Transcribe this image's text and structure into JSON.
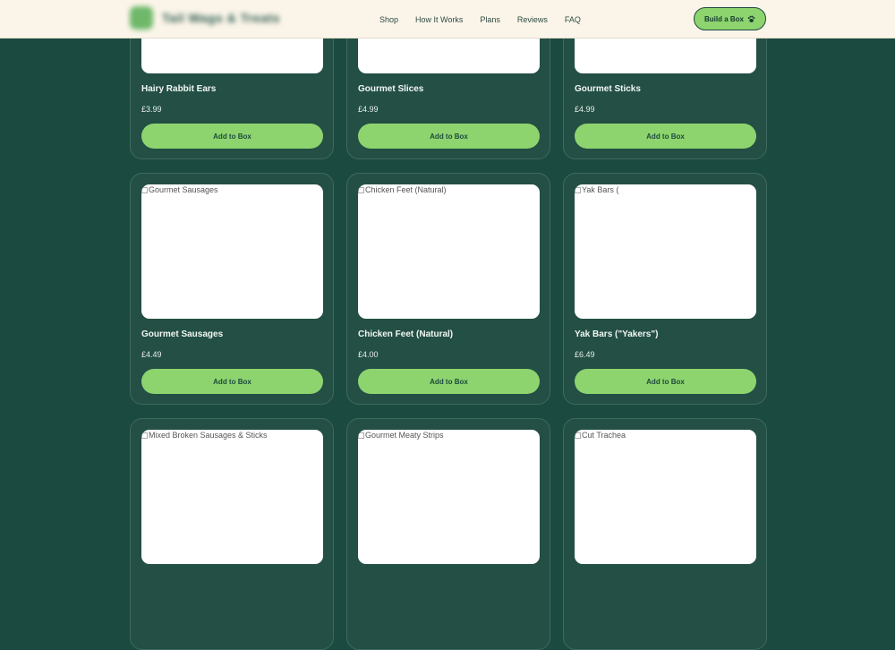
{
  "header": {
    "brand": "Tail Wags & Treats",
    "nav": [
      "Shop",
      "How It Works",
      "Plans",
      "Reviews",
      "FAQ"
    ],
    "cta_label": "Build a Box"
  },
  "products": [
    {
      "name": "Hairy Rabbit Ears",
      "price": "£3.99",
      "alt": "",
      "button": "Add to Box"
    },
    {
      "name": "Gourmet Slices",
      "price": "£4.99",
      "alt": "",
      "button": "Add to Box"
    },
    {
      "name": "Gourmet Sticks",
      "price": "£4.99",
      "alt": "",
      "button": "Add to Box"
    },
    {
      "name": "Gourmet Sausages",
      "price": "£4.49",
      "alt": "Gourmet Sausages",
      "button": "Add to Box"
    },
    {
      "name": "Chicken Feet (Natural)",
      "price": "£4.00",
      "alt": "Chicken Feet (Natural)",
      "button": "Add to Box"
    },
    {
      "name": "Yak Bars (\"Yakers\")",
      "price": "£6.49",
      "alt": "Yak Bars (",
      "button": "Add to Box"
    },
    {
      "name": "",
      "price": "",
      "alt": "Mixed Broken Sausages & Sticks",
      "button": ""
    },
    {
      "name": "",
      "price": "",
      "alt": "Gourmet Meaty Strips",
      "button": ""
    },
    {
      "name": "",
      "price": "",
      "alt": "Cut Trachea",
      "button": ""
    }
  ],
  "colors": {
    "page_bg": "#1b4a40",
    "header_bg": "#fbf5e9",
    "accent": "#8dd46e",
    "card_bg": "#234f45"
  }
}
